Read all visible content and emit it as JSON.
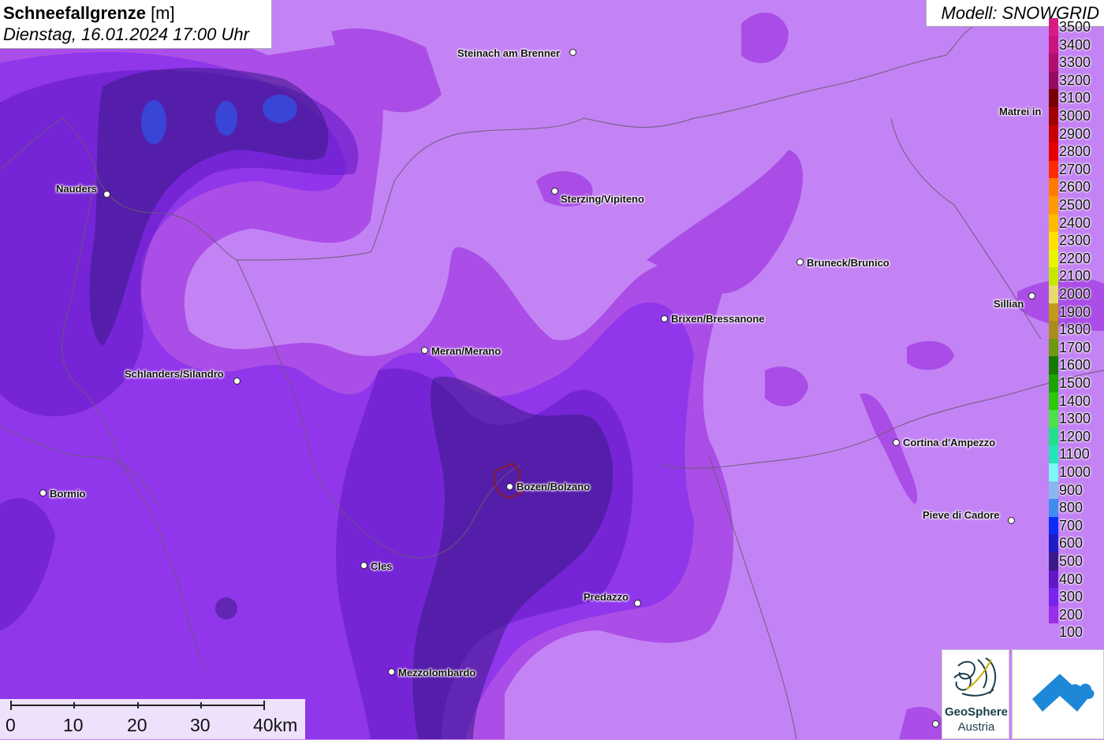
{
  "header": {
    "title_bold": "Schneefallgrenze",
    "title_unit": " [m]",
    "datetime": "Dienstag, 16.01.2024 17:00 Uhr"
  },
  "model": {
    "label": "Modell: SNOWGRID"
  },
  "legend": {
    "items": [
      {
        "label": "3500",
        "color": "#d81b87"
      },
      {
        "label": "3400",
        "color": "#c9147e"
      },
      {
        "label": "3300",
        "color": "#b00d6f"
      },
      {
        "label": "3200",
        "color": "#960a60"
      },
      {
        "label": "3100",
        "color": "#7a0000"
      },
      {
        "label": "3000",
        "color": "#a00000"
      },
      {
        "label": "2900",
        "color": "#c80000"
      },
      {
        "label": "2800",
        "color": "#e60000"
      },
      {
        "label": "2700",
        "color": "#ff2a00"
      },
      {
        "label": "2600",
        "color": "#ff7a00"
      },
      {
        "label": "2500",
        "color": "#ff9a00"
      },
      {
        "label": "2400",
        "color": "#ffbb00"
      },
      {
        "label": "2300",
        "color": "#ffe100"
      },
      {
        "label": "2200",
        "color": "#e8f500"
      },
      {
        "label": "2100",
        "color": "#c6e700"
      },
      {
        "label": "2000",
        "color": "#e4dc6a"
      },
      {
        "label": "1900",
        "color": "#c29a18"
      },
      {
        "label": "1800",
        "color": "#a88e1a"
      },
      {
        "label": "1700",
        "color": "#6e9a10"
      },
      {
        "label": "1600",
        "color": "#157a00"
      },
      {
        "label": "1500",
        "color": "#1aa400"
      },
      {
        "label": "1400",
        "color": "#2cc80a"
      },
      {
        "label": "1300",
        "color": "#4ce04a"
      },
      {
        "label": "1200",
        "color": "#22e08a"
      },
      {
        "label": "1100",
        "color": "#24e6b5"
      },
      {
        "label": "1000",
        "color": "#7ef6f6"
      },
      {
        "label": "900",
        "color": "#88b8f0"
      },
      {
        "label": "800",
        "color": "#3f8cf0"
      },
      {
        "label": "700",
        "color": "#0a2cf5"
      },
      {
        "label": "600",
        "color": "#1d1bc4"
      },
      {
        "label": "500",
        "color": "#3a1a86"
      },
      {
        "label": "400",
        "color": "#5f18c4"
      },
      {
        "label": "300",
        "color": "#7a22ee"
      },
      {
        "label": "200",
        "color": "#9a2de8"
      },
      {
        "label": "100",
        "color": "#c483f5"
      }
    ]
  },
  "cities": [
    {
      "name": "Steinach am Brenner"
    },
    {
      "name": "Nauders"
    },
    {
      "name": "Sterzing/Vipiteno"
    },
    {
      "name": "Matrei in"
    },
    {
      "name": "Bruneck/Brunico"
    },
    {
      "name": "Sillian"
    },
    {
      "name": "Brixen/Bressanone"
    },
    {
      "name": "Meran/Merano"
    },
    {
      "name": "Schlanders/Silandro"
    },
    {
      "name": "Cortina d'Ampezzo"
    },
    {
      "name": "Bozen/Bolzano"
    },
    {
      "name": "Bormio"
    },
    {
      "name": "Pieve di Cadore"
    },
    {
      "name": "Cles"
    },
    {
      "name": "Predazzo"
    },
    {
      "name": "Mezzolombardo"
    }
  ],
  "scale": {
    "labels": [
      "0",
      "10",
      "20",
      "30",
      "40km"
    ]
  },
  "logos": {
    "geosphere_line1": "GeoSphere",
    "geosphere_line2": "Austria"
  }
}
